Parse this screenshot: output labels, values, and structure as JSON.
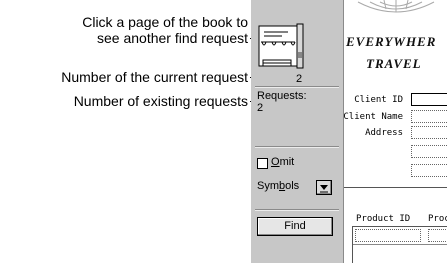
{
  "callouts": {
    "page_click_line1": "Click a page of the book to",
    "page_click_line2": "see another find request",
    "current_request": "Number of the current request",
    "existing_requests": "Number of existing requests"
  },
  "status_area": {
    "current_request_number": "2",
    "requests_label": "Requests:",
    "requests_count": "2",
    "omit_label_u": "O",
    "omit_label_rest": "mit",
    "symbols_label_pre": "Sym",
    "symbols_label_u": "b",
    "symbols_label_post": "ols",
    "find_button": "Find"
  },
  "layout": {
    "company_line1": "EVERYWHER",
    "company_line2": "TRAVEL",
    "client_id_label": "Client ID",
    "client_name_label": "Client Name",
    "address_label": "Address",
    "product_id_label": "Product ID",
    "product_col2_label": "Proc"
  },
  "colors": {
    "status_bg": "#c7c7c7",
    "layout_bg": "#ffffff"
  }
}
